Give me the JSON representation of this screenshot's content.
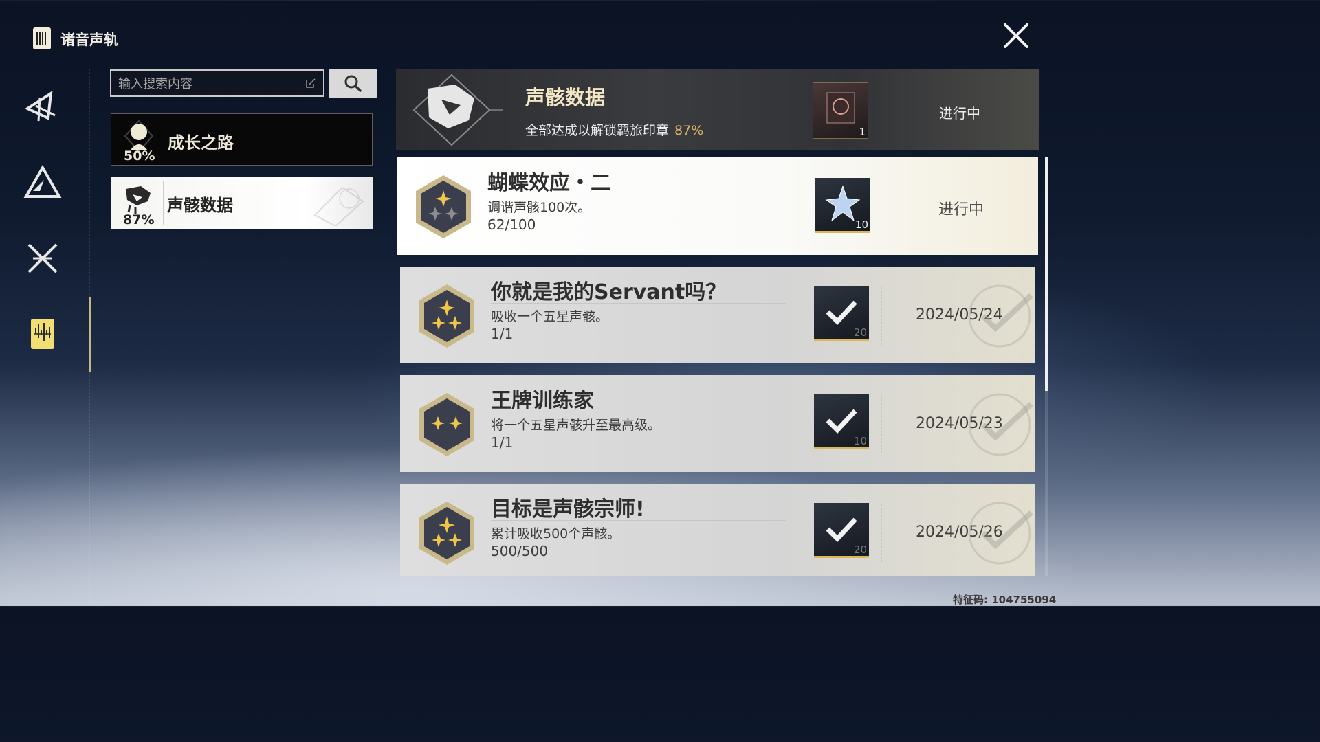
{
  "header": {
    "title": "诸音声轨",
    "icon": "sound-track-icon"
  },
  "rail": {
    "items": [
      {
        "icon": "triangle-glyph-icon"
      },
      {
        "icon": "mountain-glyph-icon"
      },
      {
        "icon": "crossed-swords-icon"
      },
      {
        "icon": "sound-track-icon",
        "selected": true
      }
    ]
  },
  "search": {
    "placeholder": "输入搜索内容"
  },
  "categories": [
    {
      "label": "成长之路",
      "percent": "50%",
      "icon": "character-portrait-icon"
    },
    {
      "label": "声骸数据",
      "percent": "87%",
      "icon": "echo-data-icon",
      "selected": true
    }
  ],
  "banner": {
    "title": "声骸数据",
    "subtitle": "全部达成以解锁羁旅印章",
    "percent": "87%",
    "reward_count": "1",
    "status": "进行中"
  },
  "achievements": [
    {
      "title": "蝴蝶效应・二",
      "desc": "调谐声骸100次。",
      "progress": "62/100",
      "reward_count": "10",
      "status": "进行中",
      "completed": false
    },
    {
      "title": "你就是我的Servant吗？",
      "desc": "吸收一个五星声骸。",
      "progress": "1/1",
      "reward_count": "20",
      "date": "2024/05/24",
      "completed": true
    },
    {
      "title": "王牌训练家",
      "desc": "将一个五星声骸升至最高级。",
      "progress": "1/1",
      "reward_count": "10",
      "date": "2024/05/23",
      "completed": true
    },
    {
      "title": "目标是声骸宗师!",
      "desc": "累计吸收500个声骸。",
      "progress": "500/500",
      "reward_count": "20",
      "date": "2024/05/26",
      "completed": true
    }
  ],
  "footer": {
    "feature_code": "特征码: 104755094"
  },
  "colors": {
    "accent_gold": "#d6b463",
    "banner_title": "#f3e6c4"
  }
}
